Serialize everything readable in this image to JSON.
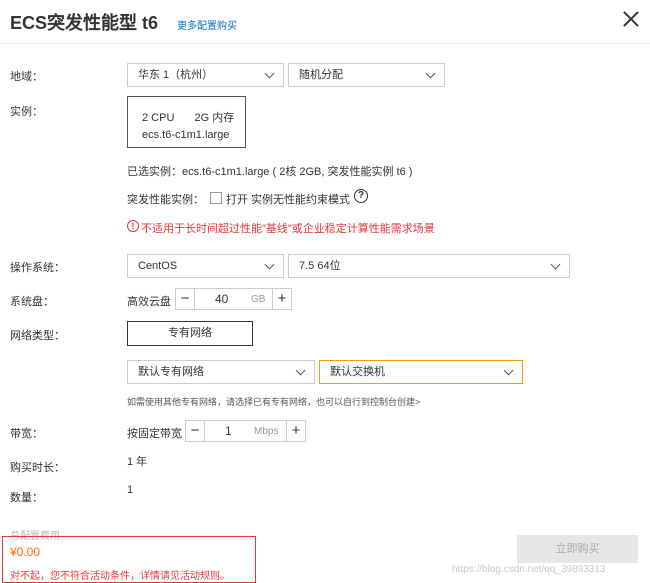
{
  "header": {
    "title": "ECS突发性能型 t6",
    "more_link": "更多配置购买"
  },
  "labels": {
    "region": "地域：",
    "instance": "实例：",
    "os": "操作系统：",
    "disk": "系统盘：",
    "network": "网络类型：",
    "bandwidth": "带宽：",
    "duration": "购买时长：",
    "quantity": "数量："
  },
  "region": {
    "selected": "华东 1（杭州）",
    "zone": "随机分配"
  },
  "instance": {
    "cpu": "2 CPU",
    "memory": "2G 内存",
    "type": "ecs.t6-c1m1.large",
    "selected_text": "已选实例：ecs.t6-c1m1.large ( 2核 2GB, 突发性能实例 t6 )",
    "burst_label": "突发性能实例：",
    "burst_option": "打开 实例无性能约束模式",
    "warning": "不适用于长时间超过性能\"基线\"或企业稳定计算性能需求场景"
  },
  "os": {
    "name": "CentOS",
    "version": "7.5 64位"
  },
  "disk": {
    "type": "高效云盘",
    "size": "40",
    "unit": "GB"
  },
  "network": {
    "type_button": "专有网络",
    "vpc": "默认专有网络",
    "vswitch": "默认交换机",
    "hint": "如需使用其他专有网络，请选择已有专有网络，也可以自行到控制台创建>"
  },
  "bandwidth": {
    "mode": "按固定带宽",
    "value": "1",
    "unit": "Mbps"
  },
  "duration": {
    "value": "1 年"
  },
  "quantity": {
    "value": "1"
  },
  "cost": {
    "label": "总配置费用",
    "price": "¥0.00",
    "message": "对不起，您不符合活动条件，详情请见活动规则。"
  },
  "buy_button": "立即购买",
  "watermark": "https://blog.csdn.net/qq_39893313",
  "colors": {
    "accent_link": "#0070cc",
    "warning": "#e4393c",
    "price": "#ff6a00",
    "vswitch_border": "#ff9900"
  }
}
